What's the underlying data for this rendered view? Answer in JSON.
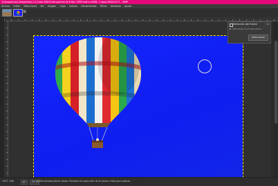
{
  "window": {
    "title": "[Composicion] (importada)-1.0 (Color RGB 8 bits gamma de 8 bits, GIMP built-in sRGB, 1 capa) 4000x2717 – GIMP"
  },
  "menubar": {
    "items": [
      "Archivo",
      "Editar",
      "Seleccionar",
      "Ver",
      "Imagen",
      "Capa",
      "Colores",
      "Herramientas",
      "Filtros",
      "Ventanas",
      "Ayuda"
    ]
  },
  "tabs": [
    {
      "name": "landscape-thumbnail",
      "active": false
    },
    {
      "name": "balloon-thumbnail",
      "active": true
    }
  ],
  "dock": {
    "title": "Selección del frente",
    "rows": [
      "Marcando el primer plano"
    ],
    "button_label": "Seleccionar"
  },
  "statusbar": {
    "coords": "1457, 946",
    "unit": "px",
    "zoom": "33 %",
    "message": "Seleccionado primer plano. Presione Ins para salir de la pinza e Intro para aplicar."
  },
  "colors": {
    "titlebar": "#e5087b",
    "canvas_background": "#1426ff",
    "selection_outline": "#ffe600"
  }
}
